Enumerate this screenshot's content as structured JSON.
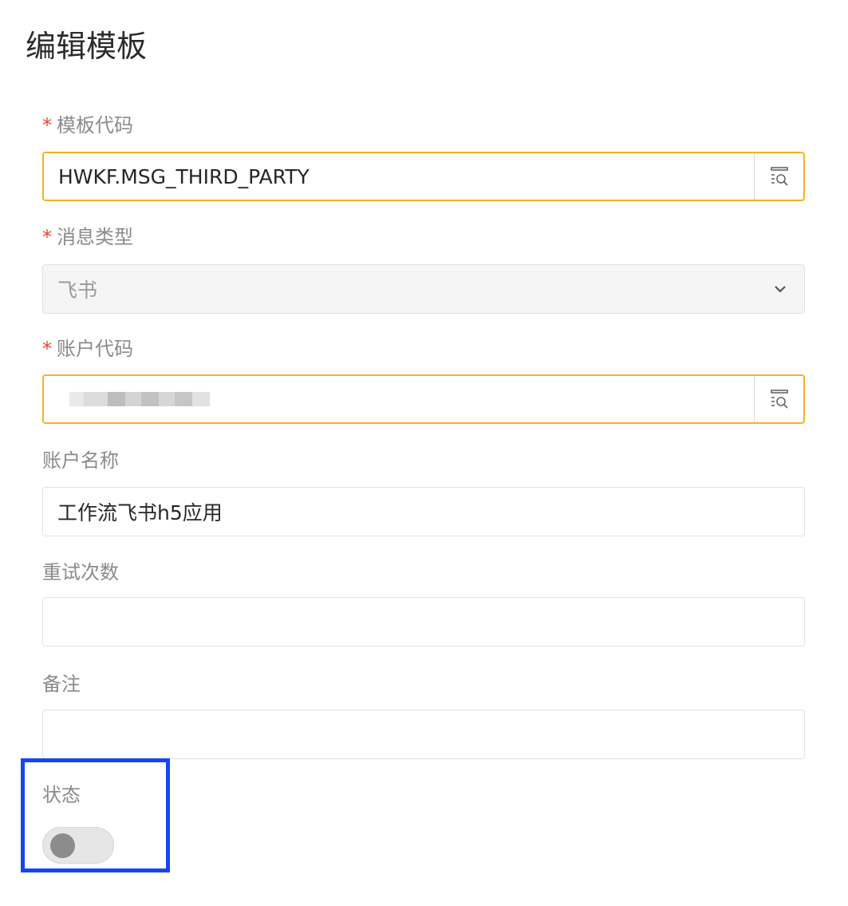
{
  "page": {
    "title": "编辑模板"
  },
  "form": {
    "template_code": {
      "label": "模板代码",
      "required_mark": "*",
      "value": "HWKF.MSG_THIRD_PARTY",
      "icon": "lov-search-icon"
    },
    "message_type": {
      "label": "消息类型",
      "required_mark": "*",
      "value": "飞书",
      "icon": "chevron-down-icon"
    },
    "account_code": {
      "label": "账户代码",
      "required_mark": "*",
      "value": "",
      "icon": "lov-search-icon"
    },
    "account_name": {
      "label": "账户名称",
      "value": "工作流飞书h5应用"
    },
    "retry_count": {
      "label": "重试次数",
      "value": ""
    },
    "remark": {
      "label": "备注",
      "value": ""
    },
    "status": {
      "label": "状态",
      "enabled": false
    }
  },
  "colors": {
    "required": "#e8452f",
    "focus_border": "#f3b324",
    "highlight": "#1646f0",
    "label": "#8a8a8a"
  }
}
